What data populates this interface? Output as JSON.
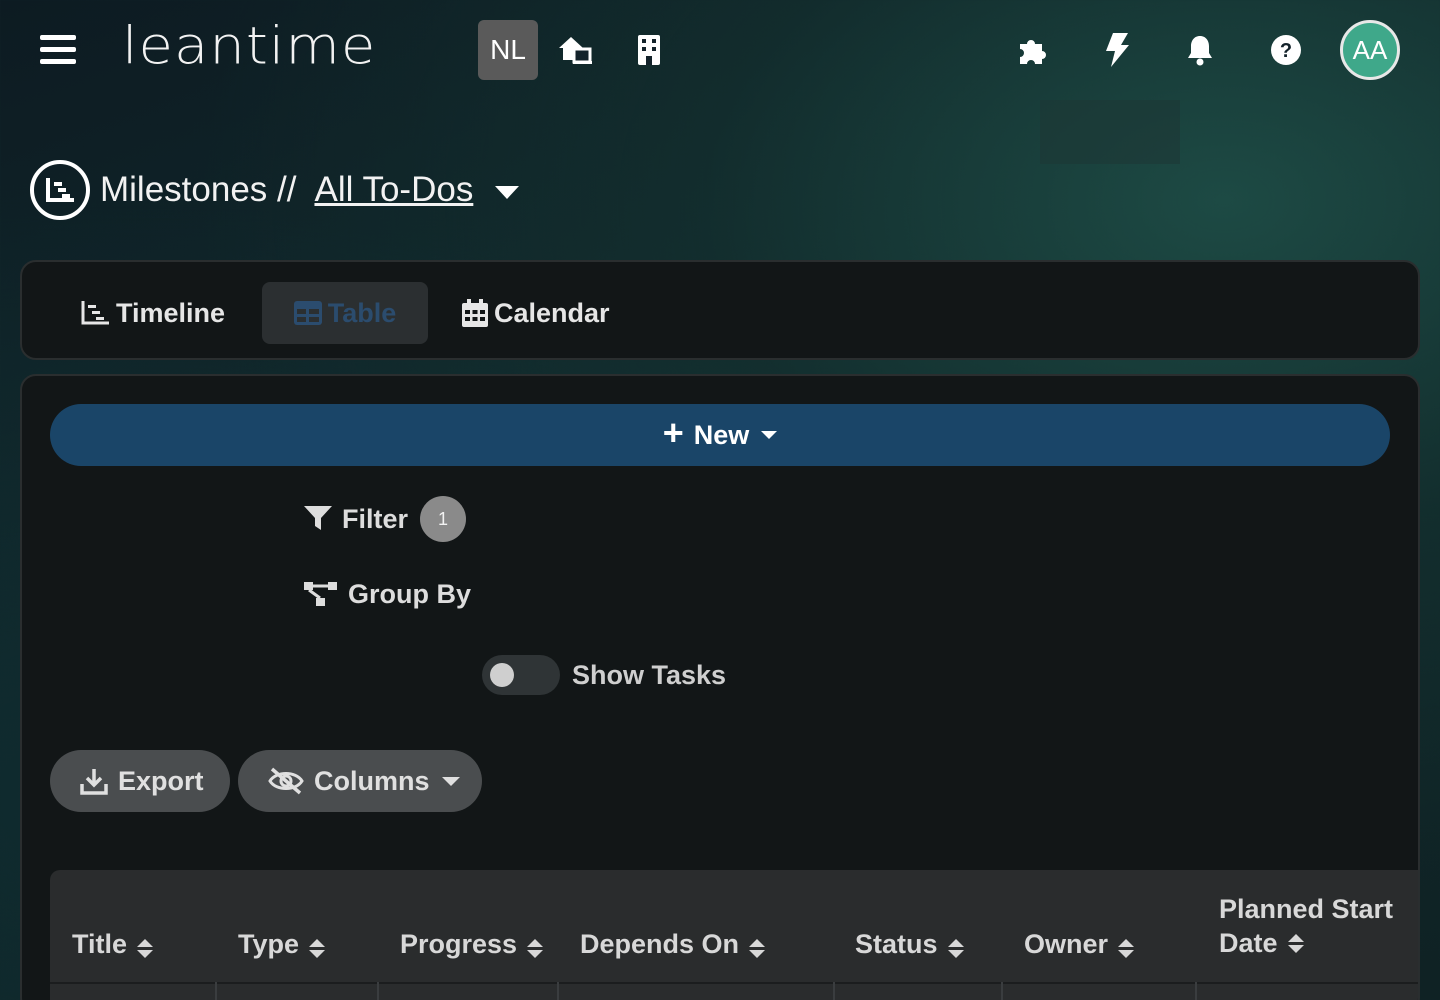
{
  "app": {
    "logo_text": "leantime"
  },
  "header": {
    "workspace_badge": "NL",
    "avatar_initials": "AA",
    "icons": [
      "menu-icon",
      "home-switch-icon",
      "building-icon",
      "puzzle-icon",
      "bolt-icon",
      "bell-icon",
      "help-icon"
    ]
  },
  "breadcrumb": {
    "section": "Milestones //",
    "current": "All To-Dos "
  },
  "tabs": [
    {
      "label": "Timeline",
      "icon": "timeline-icon",
      "active": false
    },
    {
      "label": "Table",
      "icon": "table-icon",
      "active": true
    },
    {
      "label": "Calendar",
      "icon": "calendar-icon",
      "active": false
    }
  ],
  "toolbar": {
    "new_label": "New",
    "filter_label": "Filter",
    "filter_count": "1",
    "group_by_label": "Group By",
    "show_tasks_label": "Show Tasks",
    "show_tasks_on": false,
    "export_label": "Export",
    "columns_label": "Columns"
  },
  "table": {
    "columns": [
      "Title",
      "Type",
      "Progress",
      "Depends On",
      "Status",
      "Owner",
      "Planned Start Date"
    ]
  },
  "colors": {
    "accent_button": "#1a4568",
    "active_tab_text": "#2b4c6e",
    "avatar": "#3fa88a",
    "panel": "#121617"
  }
}
